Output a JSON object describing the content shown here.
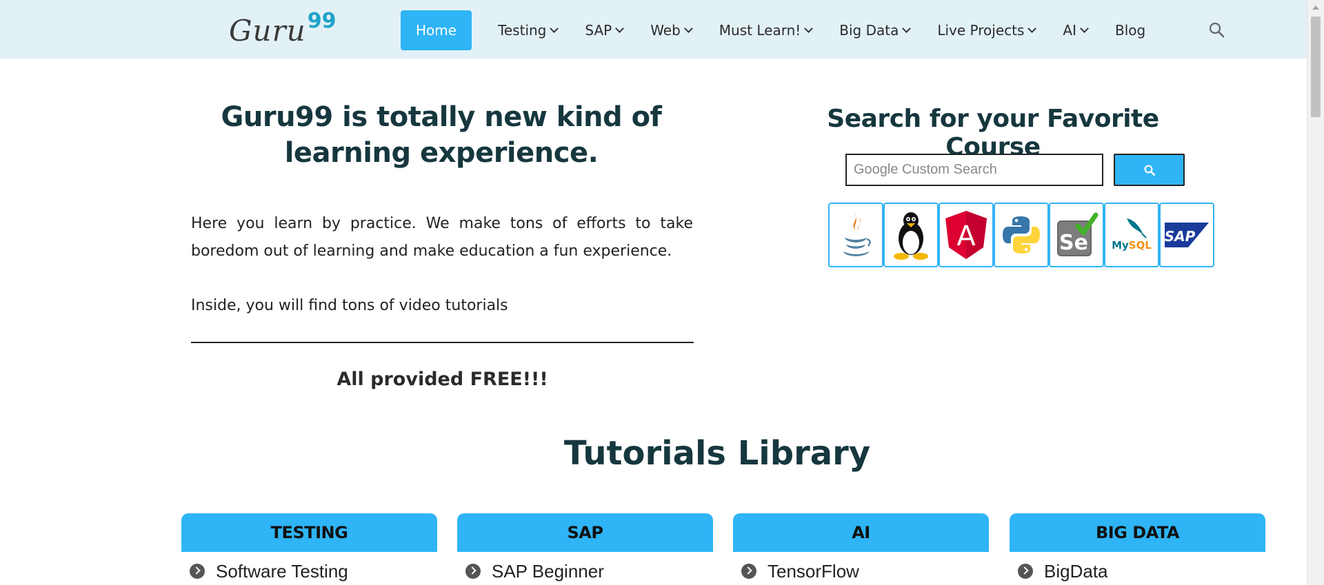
{
  "header": {
    "logo_text": "Guru",
    "logo_num": "99",
    "nav": [
      {
        "label": "Home",
        "active": true,
        "dropdown": false
      },
      {
        "label": "Testing",
        "dropdown": true
      },
      {
        "label": "SAP",
        "dropdown": true
      },
      {
        "label": "Web",
        "dropdown": true
      },
      {
        "label": "Must Learn!",
        "dropdown": true
      },
      {
        "label": "Big Data",
        "dropdown": true
      },
      {
        "label": "Live Projects",
        "dropdown": true
      },
      {
        "label": "AI",
        "dropdown": true
      },
      {
        "label": "Blog",
        "dropdown": false
      }
    ]
  },
  "hero": {
    "title": "Guru99 is totally new kind of learning experience.",
    "para1": "Here you learn by practice. We make tons of efforts to take boredom out of learning and make education a fun experience.",
    "para2": "Inside, you will find tons of video tutorials",
    "free": "All provided FREE!!!"
  },
  "search": {
    "title": "Search for your Favorite Course",
    "placeholder": "Google Custom Search",
    "tiles": [
      {
        "name": "java-icon"
      },
      {
        "name": "linux-icon"
      },
      {
        "name": "angular-icon",
        "label": "A"
      },
      {
        "name": "python-icon"
      },
      {
        "name": "selenium-icon",
        "label": "Se"
      },
      {
        "name": "mysql-icon",
        "label": "MySQL"
      },
      {
        "name": "sap-icon",
        "label": "SAP"
      }
    ]
  },
  "library": {
    "title": "Tutorials Library",
    "categories": [
      {
        "head": "TESTING",
        "items": [
          "Software Testing"
        ]
      },
      {
        "head": "SAP",
        "items": [
          "SAP Beginner"
        ]
      },
      {
        "head": "AI",
        "items": [
          "TensorFlow"
        ]
      },
      {
        "head": "BIG DATA",
        "items": [
          "BigData"
        ]
      }
    ]
  },
  "colors": {
    "nav_bg": "#e2f1f6",
    "accent": "#2fb4f5",
    "heading": "#16373e"
  }
}
